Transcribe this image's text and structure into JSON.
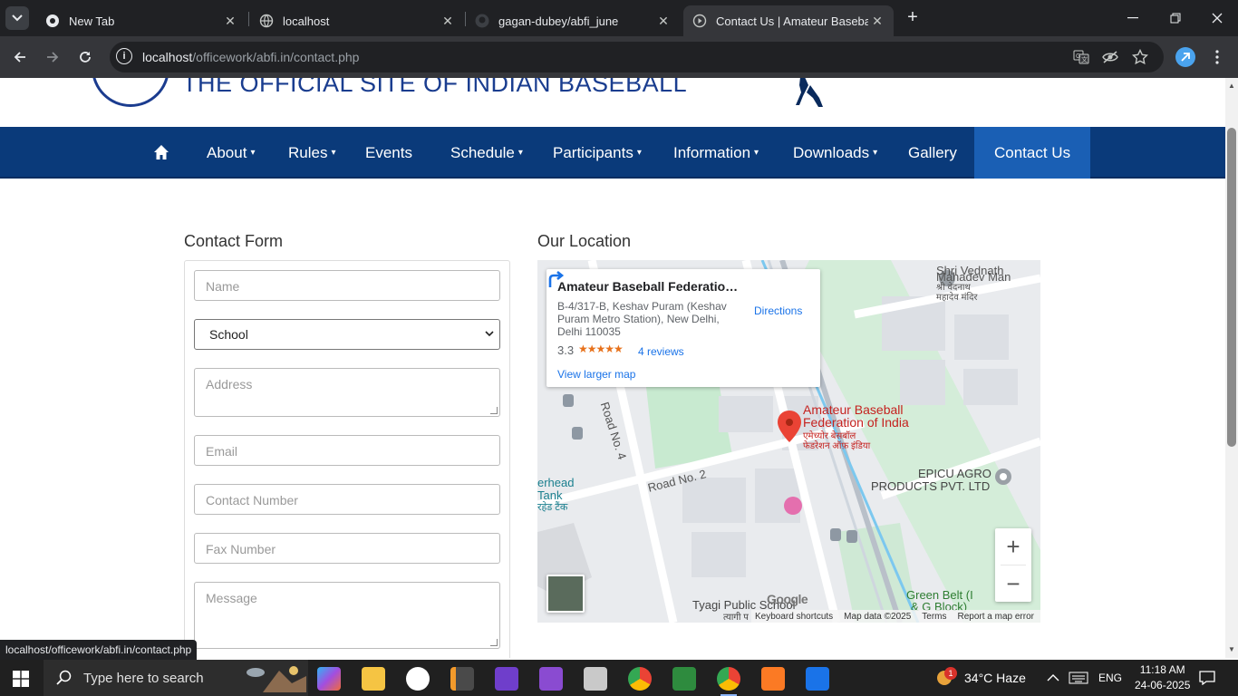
{
  "browser": {
    "tabs": [
      {
        "title": "New Tab",
        "icon": "chrome-icon",
        "active": false
      },
      {
        "title": "localhost",
        "icon": "globe-icon",
        "active": false
      },
      {
        "title": "gagan-dubey/abfi_june",
        "icon": "github-icon",
        "active": false
      },
      {
        "title": "Contact Us | Amateur Baseball F",
        "icon": "site-icon",
        "active": true
      }
    ],
    "url_host": "localhost",
    "url_path": "/officework/abfi.in/contact.php",
    "status_url": "localhost/officework/abfi.in/contact.php"
  },
  "header": {
    "site_title": "THE OFFICIAL SITE OF INDIAN BASEBALL"
  },
  "nav": {
    "items": [
      {
        "label": "About",
        "dropdown": true
      },
      {
        "label": "Rules",
        "dropdown": true
      },
      {
        "label": "Events",
        "dropdown": false
      },
      {
        "label": "Schedule",
        "dropdown": true
      },
      {
        "label": "Participants",
        "dropdown": true
      },
      {
        "label": "Information",
        "dropdown": true
      },
      {
        "label": "Downloads",
        "dropdown": true
      },
      {
        "label": "Gallery",
        "dropdown": false
      },
      {
        "label": "Contact Us",
        "dropdown": false,
        "active": true
      }
    ],
    "caret": "▾",
    "colors": {
      "bar": "#0a3a7a",
      "active": "#1a5fb4"
    }
  },
  "contact_form": {
    "title": "Contact Form",
    "name_placeholder": "Name",
    "type_selected": "School",
    "address_placeholder": "Address",
    "email_placeholder": "Email",
    "contact_placeholder": "Contact Number",
    "fax_placeholder": "Fax Number",
    "message_placeholder": "Message"
  },
  "location": {
    "title": "Our Location",
    "card": {
      "name": "Amateur Baseball Federation ...",
      "address": "B-4/317-B, Keshav Puram (Keshav Puram Metro Station), New Delhi, Delhi 110035",
      "rating": "3.3",
      "stars": "★★★★★",
      "reviews": "4 reviews",
      "view_larger": "View larger map",
      "directions": "Directions"
    },
    "labels": {
      "temple_en": "Shri Vednath",
      "temple_en2": "Mahadev Man",
      "temple_hi": "श्री वेदनाथ",
      "temple_hi2": "महादेव मंदिर",
      "place_en": "Amateur Baseball",
      "place_en2": "Federation of India",
      "place_hi": "एमेच्योर बेसबॉल",
      "place_hi2": "फेडरेशन ऑफ़ इंडिया",
      "epicu": "EPICU AGRO",
      "epicu2": "PRODUCTS PVT. LTD",
      "road2": "Road No. 2",
      "road4": "Road No. 4",
      "tank": "erhead",
      "tank2": "Tank",
      "tank_hi": "रहेड टैंक",
      "school": "Tyagi Public School",
      "school_hi": "त्यागी प",
      "green_belt": "Green Belt (I",
      "green_belt2": "& G Block)"
    },
    "google": "Google",
    "footer": {
      "keyboard": "Keyboard shortcuts",
      "mapdata": "Map data ©2025",
      "terms": "Terms",
      "report": "Report a map error"
    },
    "zoom_in": "+",
    "zoom_out": "−"
  },
  "taskbar": {
    "search_placeholder": "Type here to search",
    "weather": "34°C  Haze",
    "weather_badge": "1",
    "lang": "ENG",
    "time": "11:18 AM",
    "date": "24-06-2025"
  }
}
